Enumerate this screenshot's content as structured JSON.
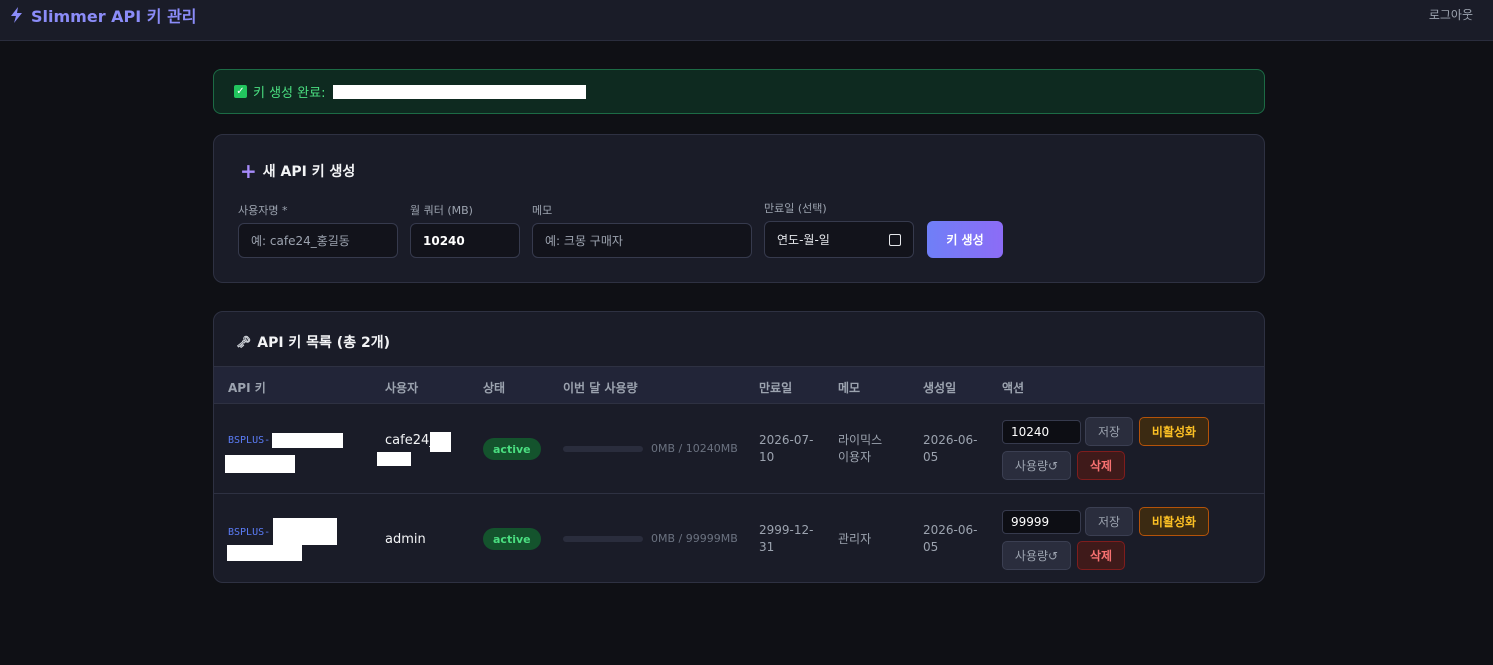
{
  "header": {
    "title": "Slimmer API 키 관리",
    "logout": "로그아웃"
  },
  "alert": {
    "text": "키 생성 완료:"
  },
  "create": {
    "title": "새 API 키 생성",
    "fields": {
      "username_label": "사용자명 *",
      "username_placeholder": "예: cafe24_홍길동",
      "quota_label": "월 쿼터 (MB)",
      "quota_value": "10240",
      "memo_label": "메모",
      "memo_placeholder": "예: 크몽 구매자",
      "expiry_label": "만료일 (선택)",
      "expiry_placeholder": "연도-월-일"
    },
    "submit": "키 생성"
  },
  "list": {
    "title": "API 키 목록 (총 2개)",
    "columns": [
      "API 키",
      "사용자",
      "상태",
      "이번 달 사용량",
      "만료일",
      "메모",
      "생성일",
      "액션"
    ],
    "rows": [
      {
        "key_prefix": "BSPLUS-",
        "user": "cafe24_",
        "status": "active",
        "usage_text": "0MB / 10240MB",
        "usage_fraction": 0,
        "expiry_line1": "2026-07-",
        "expiry_line2": "10",
        "memo_line1": "라이믹스",
        "memo_line2": "이용자",
        "created_line1": "2026-06-",
        "created_line2": "05",
        "quota": "10240"
      },
      {
        "key_prefix": "BSPLUS-",
        "user": "admin",
        "status": "active",
        "usage_text": "0MB / 99999MB",
        "usage_fraction": 0,
        "expiry_line1": "2999-12-",
        "expiry_line2": "31",
        "memo_line1": "관리자",
        "memo_line2": "",
        "created_line1": "2026-06-",
        "created_line2": "05",
        "quota": "99999"
      }
    ],
    "actions": {
      "save": "저장",
      "deactivate": "비활성화",
      "reset_usage": "사용량↺",
      "delete": "삭제"
    }
  },
  "colors": {
    "accent": "#8b8cf8",
    "success": "#4ade80",
    "warning": "#fbbf24",
    "danger": "#f87171"
  },
  "icons": {
    "brand": "lightning-icon",
    "alert": "check-icon",
    "create": "plus-icon",
    "list": "key-icon"
  }
}
